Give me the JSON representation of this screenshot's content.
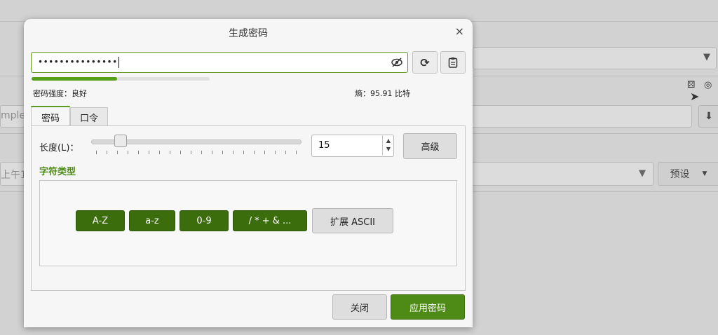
{
  "background": {
    "url_fragment": "mple.c",
    "date_fragment": "上午1",
    "preset_label": "预设"
  },
  "dialog": {
    "title": "生成密码",
    "close_glyph": "×",
    "password_masked": "•••••••••••••••",
    "strength_label": "密码强度：良好",
    "strength_fraction": 0.48,
    "entropy_label": "熵：95.91 比特",
    "regenerate_glyph": "⟳",
    "copy_glyph": "📋",
    "tabs": [
      "密码",
      "口令"
    ],
    "length_label": "长度(L)：",
    "length_value": "15",
    "advanced_button": "高级",
    "char_types_title": "字符类型",
    "char_types": [
      "A-Z",
      "a-z",
      "0-9",
      "/ * + & ...",
      "扩展 ASCII"
    ],
    "close_button": "关闭",
    "apply_button": "应用密码",
    "accent_color": "#4e8a16"
  }
}
